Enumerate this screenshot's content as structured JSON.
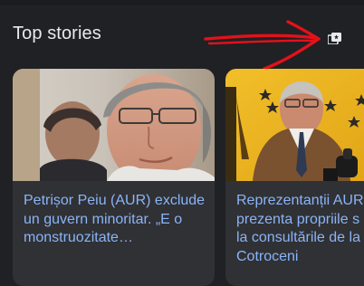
{
  "section": {
    "title": "Top stories"
  },
  "stories_icon": "stories-view-icon",
  "annotation": {
    "arrow_color": "#e3111a"
  },
  "colors": {
    "background": "#202124",
    "card_background": "#303134",
    "title_text": "#e8eaed",
    "link_text": "#8ab4f8"
  },
  "stories": [
    {
      "headline": "Petrișor Peiu (AUR) exclude un guvern minoritar. „E o monstruozitate…"
    },
    {
      "headline": "Reprezentanții AUR\nprezenta propriile s\nla consultările de la\nCotroceni"
    }
  ]
}
